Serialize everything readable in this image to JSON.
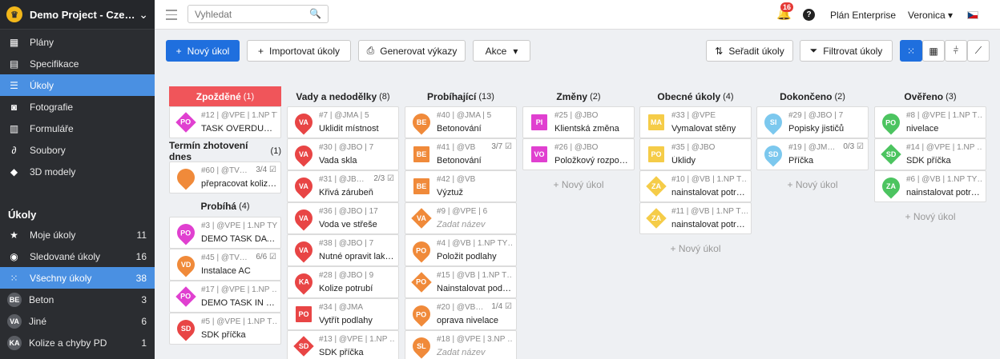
{
  "project": {
    "name": "Demo Project - Cze…",
    "logo_icon": "crown-logo-icon"
  },
  "nav": [
    {
      "label": "Plány",
      "icon": "plans-icon",
      "glyph": "▦"
    },
    {
      "label": "Specifikace",
      "icon": "book-icon",
      "glyph": "▤"
    },
    {
      "label": "Úkoly",
      "icon": "list-icon",
      "glyph": "☰",
      "active": true
    },
    {
      "label": "Fotografie",
      "icon": "camera-icon",
      "glyph": "◙"
    },
    {
      "label": "Formuláře",
      "icon": "clipboard-icon",
      "glyph": "▥"
    },
    {
      "label": "Soubory",
      "icon": "paperclip-icon",
      "glyph": "∂"
    },
    {
      "label": "3D modely",
      "icon": "cube-icon",
      "glyph": "◆"
    }
  ],
  "tasks_section": {
    "title": "Úkoly",
    "items": [
      {
        "label": "Moje úkoly",
        "count": "11",
        "glyph": "★"
      },
      {
        "label": "Sledované úkoly",
        "count": "16",
        "glyph": "◉"
      },
      {
        "label": "Všechny úkoly",
        "count": "38",
        "glyph": "⁙",
        "active": true
      },
      {
        "label": "Beton",
        "count": "3",
        "avatar": "BE"
      },
      {
        "label": "Jiné",
        "count": "6",
        "avatar": "VA"
      },
      {
        "label": "Kolize a chyby PD",
        "count": "1",
        "avatar": "KA"
      }
    ]
  },
  "topbar": {
    "search_placeholder": "Vyhledat",
    "notif_count": "16",
    "help": "?",
    "plan": "Plán Enterprise",
    "user": "Veronica ▾"
  },
  "toolbar": {
    "new_task": "Nový úkol",
    "import": "Importovat úkoly",
    "reports": "Generovat výkazy",
    "actions": "Akce",
    "sort": "Seřadit úkoly",
    "filter": "Filtrovat úkoly"
  },
  "add_label": "+ Nový úkol",
  "columns": [
    {
      "title": "Zpožděné",
      "count": "(1)",
      "late": true,
      "cards": [
        {
          "meta": "#12 | @VPE | 1.NP TY…",
          "title": "TASK OVERDUE …",
          "badge": "PO",
          "color": "#e040d0",
          "shape": "dia"
        }
      ],
      "sections": [
        {
          "title": "Termín zhotovení dnes",
          "count": "(1)",
          "cards": [
            {
              "meta": "#60 | @TV…",
              "sub": "3/4 ☑",
              "title": "přepracovat koliz…",
              "badge": "",
              "color": "#f08a3a",
              "shape": "pin"
            }
          ]
        },
        {
          "title": "Probíhá",
          "count": "(4)",
          "cards": [
            {
              "meta": "#3 | @VPE | 1.NP TYP…",
              "title": "DEMO TASK DATE",
              "badge": "PO",
              "color": "#e040d0",
              "shape": "pin"
            },
            {
              "meta": "#45 | @TV…",
              "sub": "6/6 ☑",
              "title": "Instalace AC",
              "badge": "VD",
              "color": "#f08a3a",
              "shape": "pin"
            },
            {
              "meta": "#17 | @VPE | 1.NP …",
              "title": "DEMO TASK IN …",
              "badge": "PO",
              "color": "#e040d0",
              "shape": "dia"
            },
            {
              "meta": "#5 | @VPE | 1.NP T…",
              "title": "SDK příčka",
              "badge": "SD",
              "color": "#e84545",
              "shape": "pin"
            }
          ]
        }
      ]
    },
    {
      "title": "Vady a nedodělky",
      "count": "(8)",
      "cards": [
        {
          "meta": "#7 | @JMA | 5",
          "title": "Uklidit místnost",
          "badge": "VA",
          "color": "#e84545",
          "shape": "pin"
        },
        {
          "meta": "#30 | @JBO | 7",
          "title": "Vada skla",
          "badge": "VA",
          "color": "#e84545",
          "shape": "pin"
        },
        {
          "meta": "#31 | @JB…",
          "sub": "2/3 ☑",
          "title": "Křivá zárubeň",
          "badge": "VA",
          "color": "#e84545",
          "shape": "pin"
        },
        {
          "meta": "#36 | @JBO | 17",
          "title": "Voda ve střeše",
          "badge": "VA",
          "color": "#e84545",
          "shape": "pin"
        },
        {
          "meta": "#38 | @JBO | 7",
          "title": "Nutné opravit lak…",
          "badge": "VA",
          "color": "#e84545",
          "shape": "pin"
        },
        {
          "meta": "#28 | @JBO | 9",
          "title": "Kolize potrubí",
          "badge": "KA",
          "color": "#e84545",
          "shape": "pin"
        },
        {
          "meta": "#34 | @JMA",
          "title": "Vytřít podlahy",
          "badge": "PO",
          "color": "#e84545",
          "shape": "sq"
        },
        {
          "meta": "#13 | @VPE | 1.NP …",
          "title": "SDK příčka",
          "badge": "SD",
          "color": "#e84545",
          "shape": "dia"
        }
      ]
    },
    {
      "title": "Probíhající",
      "count": "(13)",
      "cards": [
        {
          "meta": "#40 | @JMA | 5",
          "title": "Betonování",
          "badge": "BE",
          "color": "#f08a3a",
          "shape": "pin"
        },
        {
          "meta": "#41 | @VB",
          "sub": "3/7 ☑",
          "title": "Betonování",
          "badge": "BE",
          "color": "#f08a3a",
          "shape": "sq"
        },
        {
          "meta": "#42 | @VB",
          "title": "Výztuž",
          "badge": "BE",
          "color": "#f08a3a",
          "shape": "sq"
        },
        {
          "meta": "#9 | @VPE | 6",
          "title": "Zadat název",
          "italic": true,
          "badge": "VA",
          "color": "#f08a3a",
          "shape": "dia"
        },
        {
          "meta": "#4 | @VB | 1.NP TY…",
          "title": "Položit podlahy",
          "badge": "PO",
          "color": "#f08a3a",
          "shape": "pin"
        },
        {
          "meta": "#15 | @VB | 1.NP T…",
          "title": "Nainstalovat podl…",
          "badge": "PO",
          "color": "#f08a3a",
          "shape": "dia"
        },
        {
          "meta": "#20 | @VB…",
          "sub": "1/4 ☑",
          "title": "oprava nivelace",
          "badge": "PO",
          "color": "#f08a3a",
          "shape": "pin"
        },
        {
          "meta": "#18 | @VPE | 3.NP …",
          "title": "Zadat název",
          "italic": true,
          "badge": "SL",
          "color": "#f08a3a",
          "shape": "pin"
        }
      ]
    },
    {
      "title": "Změny",
      "count": "(2)",
      "add": true,
      "cards": [
        {
          "meta": "#25 | @JBO",
          "title": "Klientská změna",
          "badge": "PI",
          "color": "#e040d0",
          "shape": "sq"
        },
        {
          "meta": "#26 | @JBO",
          "title": "Položkový rozpoč…",
          "badge": "VO",
          "color": "#e040d0",
          "shape": "sq"
        }
      ]
    },
    {
      "title": "Obecné úkoly",
      "count": "(4)",
      "add": true,
      "cards": [
        {
          "meta": "#33 | @VPE",
          "title": "Vymalovat stěny",
          "badge": "MA",
          "color": "#f5cc48",
          "shape": "sq"
        },
        {
          "meta": "#35 | @JBO",
          "title": "Úklidy",
          "badge": "PO",
          "color": "#f5cc48",
          "shape": "sq"
        },
        {
          "meta": "#10 | @VB | 1.NP T…",
          "title": "nainstalovat potr…",
          "badge": "ZA",
          "color": "#f5cc48",
          "shape": "dia"
        },
        {
          "meta": "#11 | @VB | 1.NP T…",
          "title": "nainstalovat potr…",
          "badge": "ZA",
          "color": "#f5cc48",
          "shape": "dia"
        }
      ]
    },
    {
      "title": "Dokončeno",
      "count": "(2)",
      "add": true,
      "cards": [
        {
          "meta": "#29 | @JBO | 7",
          "title": "Popisky jističů",
          "badge": "SI",
          "color": "#7cc8ee",
          "shape": "pin"
        },
        {
          "meta": "#19 | @JM…",
          "sub": "0/3 ☑",
          "title": "Příčka",
          "badge": "SD",
          "color": "#7cc8ee",
          "shape": "pin"
        }
      ]
    },
    {
      "title": "Ověřeno",
      "count": "(3)",
      "add": true,
      "cards": [
        {
          "meta": "#8 | @VPE | 1.NP T…",
          "title": "nivelace",
          "badge": "PO",
          "color": "#4cc460",
          "shape": "pin"
        },
        {
          "meta": "#14 | @VPE | 1.NP …",
          "title": "SDK příčka",
          "badge": "SD",
          "color": "#4cc460",
          "shape": "dia"
        },
        {
          "meta": "#6 | @VB | 1.NP TY…",
          "title": "nainstalovat potr…",
          "badge": "ZA",
          "color": "#4cc460",
          "shape": "pin"
        }
      ]
    }
  ]
}
